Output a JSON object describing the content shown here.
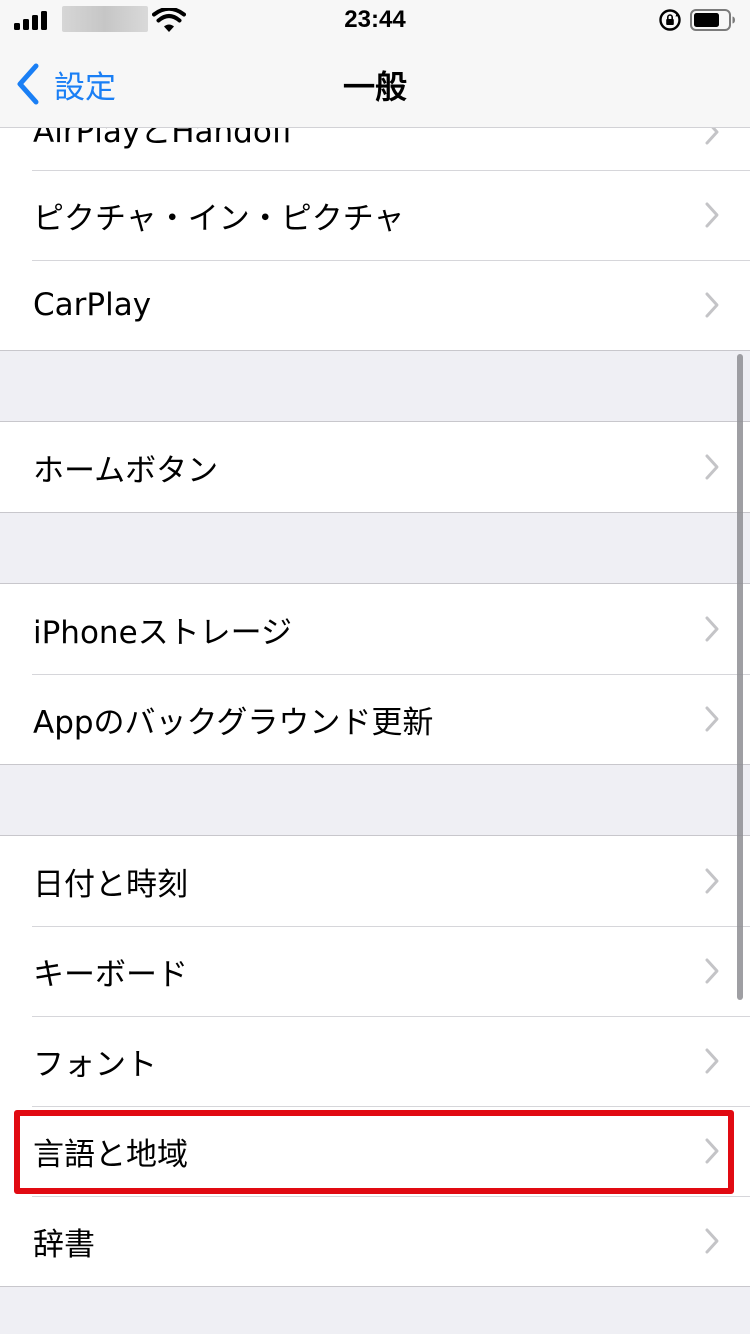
{
  "status_bar": {
    "time": "23:44"
  },
  "nav": {
    "back_label": "設定",
    "title": "一般"
  },
  "groups": [
    {
      "items": [
        {
          "label": "AirPlayとHandoff"
        },
        {
          "label": "ピクチャ・イン・ピクチャ"
        },
        {
          "label": "CarPlay"
        }
      ]
    },
    {
      "items": [
        {
          "label": "ホームボタン"
        }
      ]
    },
    {
      "items": [
        {
          "label": "iPhoneストレージ"
        },
        {
          "label": "Appのバックグラウンド更新"
        }
      ]
    },
    {
      "items": [
        {
          "label": "日付と時刻"
        },
        {
          "label": "キーボード"
        },
        {
          "label": "フォント"
        },
        {
          "label": "言語と地域"
        },
        {
          "label": "辞書"
        }
      ]
    }
  ],
  "colors": {
    "accent": "#1a7ff5",
    "highlight": "#e10a12",
    "background": "#efeff4"
  },
  "icons": [
    "signal-bars-icon",
    "wifi-icon",
    "rotation-lock-icon",
    "battery-icon",
    "chevron-left-icon",
    "chevron-right-icon"
  ]
}
